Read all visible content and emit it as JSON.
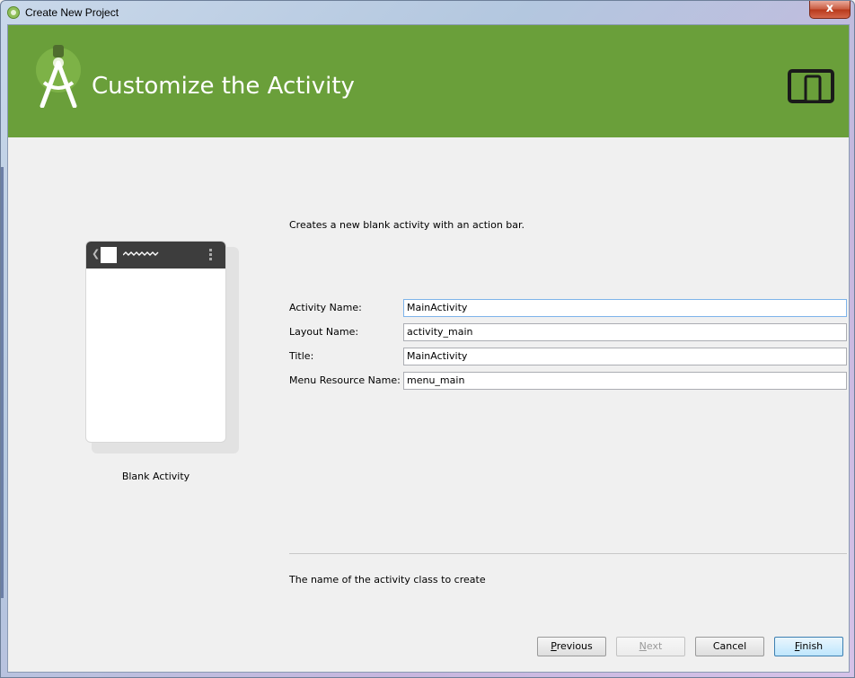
{
  "window": {
    "title": "Create New Project",
    "close_label": "x"
  },
  "header": {
    "title": "Customize the Activity",
    "bg_color": "#6a9f3a"
  },
  "preview": {
    "label": "Blank Activity"
  },
  "form": {
    "description": "Creates a new blank activity with an action bar.",
    "fields": [
      {
        "label": "Activity Name:",
        "value": "MainActivity"
      },
      {
        "label": "Layout Name:",
        "value": "activity_main"
      },
      {
        "label": "Title:",
        "value": "MainActivity"
      },
      {
        "label": "Menu Resource Name:",
        "value": "menu_main"
      }
    ],
    "help_text": "The name of the activity class to create"
  },
  "buttons": {
    "previous": {
      "mnemonic": "P",
      "rest": "revious"
    },
    "next": {
      "mnemonic": "N",
      "rest": "ext"
    },
    "cancel": "Cancel",
    "finish": {
      "mnemonic": "F",
      "rest": "inish"
    }
  }
}
